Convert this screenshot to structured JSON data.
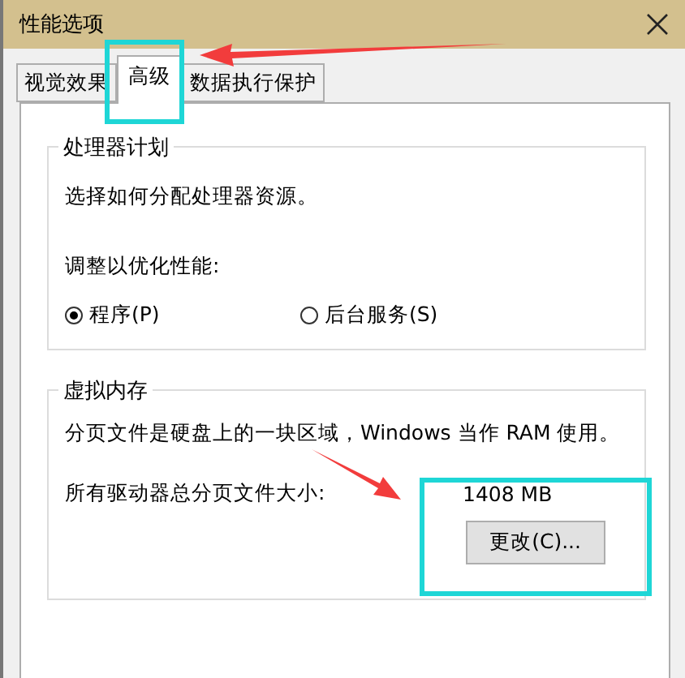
{
  "window": {
    "title": "性能选项"
  },
  "tabs": [
    {
      "label": "视觉效果",
      "selected": false
    },
    {
      "label": "高级",
      "selected": true
    },
    {
      "label": "数据执行保护",
      "selected": false
    }
  ],
  "processor_group": {
    "title": "处理器计划",
    "description": "选择如何分配处理器资源。",
    "adjust_label": "调整以优化性能:",
    "options": [
      {
        "label": "程序(P)",
        "selected": true
      },
      {
        "label": "后台服务(S)",
        "selected": false
      }
    ]
  },
  "virtual_memory_group": {
    "title": "虚拟内存",
    "description": "分页文件是硬盘上的一块区域，Windows 当作 RAM 使用。",
    "size_label": "所有驱动器总分页文件大小:",
    "size_value": "1408 MB",
    "change_button": "更改(C)..."
  }
}
